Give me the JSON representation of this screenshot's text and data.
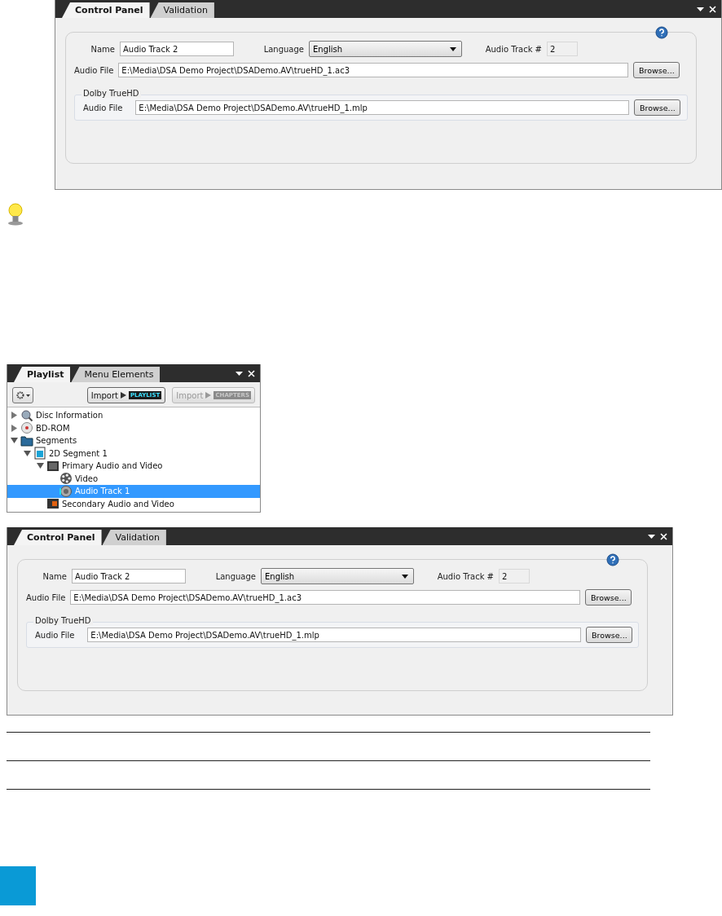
{
  "panels_top": [
    {
      "tabs": [
        {
          "label": "Control Panel",
          "selected": true
        },
        {
          "label": "Validation",
          "selected": false
        }
      ],
      "name_label": "Name",
      "name_value": "Audio Track 2",
      "language_label": "Language",
      "language_value": "English",
      "track_label": "Audio Track #",
      "track_value": "2",
      "file_label": "Audio File",
      "file_value": "E:\\Media\\DSA Demo Project\\DSADemo.AV\\trueHD_1.ac3",
      "browse": "Browse...",
      "group_title": "Dolby TrueHD",
      "group_file_label": "Audio File",
      "group_file_value": "E:\\Media\\DSA Demo Project\\DSADemo.AV\\trueHD_1.mlp",
      "group_browse": "Browse..."
    }
  ],
  "playlist": {
    "tabs": [
      {
        "label": "Playlist",
        "selected": true
      },
      {
        "label": "Menu Elements",
        "selected": false
      }
    ],
    "imports": [
      {
        "label": "Import",
        "badge": "PLAYLIST",
        "disabled": false
      },
      {
        "label": "Import",
        "badge": "CHAPTERS",
        "disabled": true
      }
    ],
    "tree": [
      {
        "label": "Disc Information",
        "kind": "search",
        "expanded": false,
        "selected": false
      },
      {
        "label": "BD-ROM",
        "kind": "disc",
        "expanded": false,
        "selected": false
      },
      {
        "label": "Segments",
        "kind": "folder",
        "expanded": true,
        "selected": false,
        "children": [
          {
            "label": "2D Segment 1",
            "kind": "clip",
            "expanded": true,
            "selected": false,
            "children": [
              {
                "label": "Primary Audio and Video",
                "kind": "monitor",
                "expanded": true,
                "selected": false,
                "children": [
                  {
                    "label": "Video",
                    "kind": "reel",
                    "selected": false
                  },
                  {
                    "label": "Audio Track 1",
                    "kind": "speaker",
                    "selected": true
                  }
                ]
              },
              {
                "label": "Secondary Audio and Video",
                "kind": "monitor2",
                "selected": false
              }
            ]
          }
        ]
      }
    ]
  },
  "panels_bottom": [
    {
      "tabs": [
        {
          "label": "Control Panel",
          "selected": true
        },
        {
          "label": "Validation",
          "selected": false
        }
      ],
      "name_label": "Name",
      "name_value": "Audio Track 2",
      "language_label": "Language",
      "language_value": "English",
      "track_label": "Audio Track #",
      "track_value": "2",
      "file_label": "Audio File",
      "file_value": "E:\\Media\\DSA Demo Project\\DSADemo.AV\\trueHD_1.ac3",
      "browse": "Browse...",
      "group_title": "Dolby TrueHD",
      "group_file_label": "Audio File",
      "group_file_value": "E:\\Media\\DSA Demo Project\\DSADemo.AV\\trueHD_1.mlp",
      "group_browse": "Browse..."
    }
  ]
}
